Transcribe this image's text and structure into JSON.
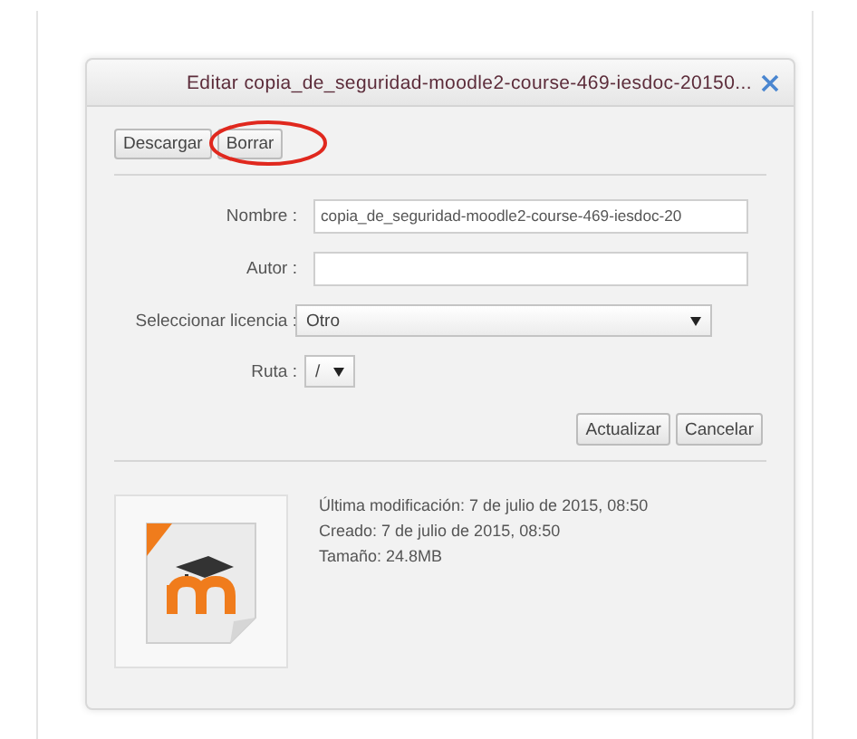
{
  "dialog": {
    "title": "Editar copia_de_seguridad-moodle2-course-469-iesdoc-20150..."
  },
  "toolbar": [
    {
      "label": "Descargar",
      "circled": false
    },
    {
      "label": "Borrar",
      "circled": true
    }
  ],
  "fields": [
    {
      "kind": "text",
      "label": "Nombre :",
      "value": "copia_de_seguridad-moodle2-course-469-iesdoc-20"
    },
    {
      "kind": "text",
      "label": "Autor :"
    },
    {
      "kind": "select",
      "label": "Seleccionar licencia :",
      "value": "Otro"
    },
    {
      "kind": "path",
      "label": "Ruta :",
      "value": "/"
    }
  ],
  "actions": [
    "Actualizar",
    "Cancelar"
  ],
  "info": [
    "Última modificación: 7 de julio de 2015, 08:50",
    "Creado: 7 de julio de 2015, 08:50",
    "Tamaño: 24.8MB"
  ]
}
